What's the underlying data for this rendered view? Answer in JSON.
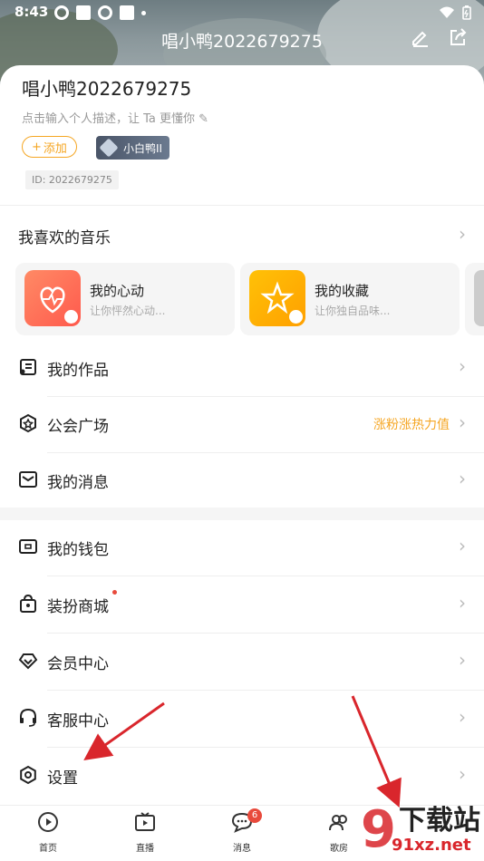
{
  "status_bar": {
    "time": "8:43"
  },
  "header": {
    "title": "唱小鸭2022679275"
  },
  "profile": {
    "username": "唱小鸭2022679275",
    "description": "点击输入个人描述，让 Ta 更懂你",
    "add_tag_label": "添加",
    "badge_label": "小白鸭II",
    "id_label": "ID: 2022679275"
  },
  "favorites": {
    "title": "我喜欢的音乐",
    "cards": [
      {
        "title": "我的心动",
        "subtitle": "让你怦然心动...",
        "color": "#ff7a59"
      },
      {
        "title": "我的收藏",
        "subtitle": "让你独自品味...",
        "color": "#ffb300"
      }
    ]
  },
  "menu_top": [
    {
      "label": "我的作品",
      "icon": "music-list-icon"
    },
    {
      "label": "公会广场",
      "icon": "guild-icon",
      "extra": "涨粉涨热力值"
    },
    {
      "label": "我的消息",
      "icon": "mail-icon"
    }
  ],
  "menu_bottom": [
    {
      "label": "我的钱包",
      "icon": "wallet-icon"
    },
    {
      "label": "装扮商城",
      "icon": "shop-icon"
    },
    {
      "label": "会员中心",
      "icon": "vip-icon"
    },
    {
      "label": "客服中心",
      "icon": "headset-icon"
    },
    {
      "label": "设置",
      "icon": "settings-icon"
    }
  ],
  "bottom_nav": [
    {
      "label": "首页",
      "icon": "home-play-icon"
    },
    {
      "label": "直播",
      "icon": "tv-icon"
    },
    {
      "label": "消息",
      "icon": "chat-icon",
      "badge": "6"
    },
    {
      "label": "歌房",
      "icon": "people-icon"
    }
  ],
  "watermark": {
    "text": "下载站",
    "url": "91xz.net"
  },
  "colors": {
    "accent": "#f5a623",
    "badge_red": "#e84a3c"
  }
}
